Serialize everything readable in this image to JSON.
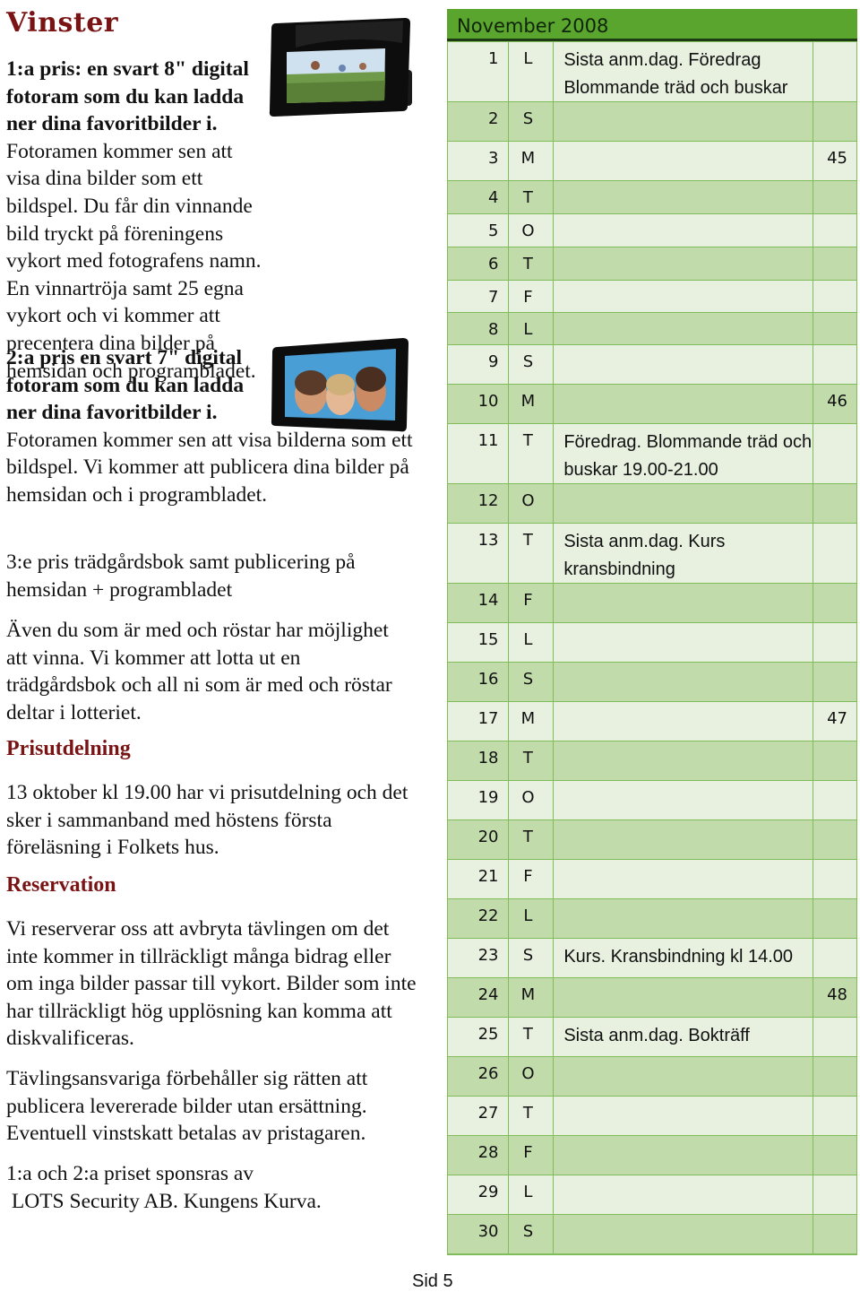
{
  "left": {
    "title": "Vinster",
    "prize1_bold": "1:a pris: en svart 8\" digital fotoram som du kan ladda ner dina favoritbilder i.",
    "prize1_text": "Fotoramen kommer sen att visa dina  bilder som ett bildspel.  Du får din vinnande bild tryckt på föreningens vykort med fotografens namn. En vinnartröja samt 25 egna vykort och vi kommer att precentera dina bilder på hemsidan  och programbladet.",
    "prize2_bold": "2:a pris en svart 7\" digital fotoram som du kan ladda ner dina favoritbilder i.",
    "prize2_text": "Fotoramen kommer sen att visa bilderna som ett bildspel. Vi kommer att publicera dina bilder på hemsidan och i programbladet.",
    "prize3": "3:e pris  trädgårdsbok samt  publicering på hemsidan + programbladet",
    "voters": "Även du som är med och röstar har möjlighet att vinna. Vi kommer att lotta ut en trädgårdsbok och all ni som är med och röstar deltar i lotteriet.",
    "heading_award": "Prisutdelning",
    "award_text": "13 oktober kl 19.00 har vi prisutdelning och det sker i sammanband med höstens första föreläsning i Folkets hus.",
    "heading_reservation": "Reservation",
    "reservation_text": "Vi reserverar oss att avbryta tävlingen om det inte kommer in tillräckligt många bidrag eller om inga bilder passar till vykort. Bilder som inte har tillräckligt hög upplösning kan komma att diskvalificeras.",
    "rights_text": "Tävlingsansvariga förbehåller sig rätten att publicera levererade bilder utan ersättning. Eventuell vinstskatt betalas av pristagaren.",
    "sponsor_line1": "1:a och 2:a priset sponsras av",
    "sponsor_line2": " LOTS Security AB. Kungens Kurva."
  },
  "images": {
    "frame1": "black 8-inch digital photo frame showing people jumping in a field",
    "frame2": "black 7-inch digital photo frame showing three smiling women"
  },
  "calendar": {
    "title": "November 2008",
    "colors": {
      "header": "#5aa52e",
      "row_light": "#e8f0e0",
      "row_dark": "#c2dbab",
      "grid": "#7fbd5a"
    },
    "rows": [
      {
        "day": "1",
        "weekday": "L",
        "event": "Sista anm.dag. Föredrag Blommande träd och buskar",
        "week": ""
      },
      {
        "day": "2",
        "weekday": "S",
        "event": "",
        "week": ""
      },
      {
        "day": "3",
        "weekday": "M",
        "event": "",
        "week": "45"
      },
      {
        "day": "4",
        "weekday": "T",
        "event": "",
        "week": ""
      },
      {
        "day": "5",
        "weekday": "O",
        "event": "",
        "week": ""
      },
      {
        "day": "6",
        "weekday": "T",
        "event": "",
        "week": ""
      },
      {
        "day": "7",
        "weekday": "F",
        "event": "",
        "week": ""
      },
      {
        "day": "8",
        "weekday": "L",
        "event": "",
        "week": ""
      },
      {
        "day": "9",
        "weekday": "S",
        "event": "",
        "week": ""
      },
      {
        "day": "10",
        "weekday": "M",
        "event": "",
        "week": "46"
      },
      {
        "day": "11",
        "weekday": "T",
        "event": "Föredrag. Blommande träd och buskar 19.00-21.00",
        "week": ""
      },
      {
        "day": "12",
        "weekday": "O",
        "event": "",
        "week": ""
      },
      {
        "day": "13",
        "weekday": "T",
        "event": "Sista anm.dag. Kurs kransbindning",
        "week": ""
      },
      {
        "day": "14",
        "weekday": "F",
        "event": "",
        "week": ""
      },
      {
        "day": "15",
        "weekday": "L",
        "event": "",
        "week": ""
      },
      {
        "day": "16",
        "weekday": "S",
        "event": "",
        "week": ""
      },
      {
        "day": "17",
        "weekday": "M",
        "event": "",
        "week": "47"
      },
      {
        "day": "18",
        "weekday": "T",
        "event": "",
        "week": ""
      },
      {
        "day": "19",
        "weekday": "O",
        "event": "",
        "week": ""
      },
      {
        "day": "20",
        "weekday": "T",
        "event": "",
        "week": ""
      },
      {
        "day": "21",
        "weekday": "F",
        "event": "",
        "week": ""
      },
      {
        "day": "22",
        "weekday": "L",
        "event": "",
        "week": ""
      },
      {
        "day": "23",
        "weekday": "S",
        "event": "Kurs. Kransbindning kl 14.00",
        "week": ""
      },
      {
        "day": "24",
        "weekday": "M",
        "event": "",
        "week": "48"
      },
      {
        "day": "25",
        "weekday": "T",
        "event": "Sista anm.dag. Bokträff",
        "week": ""
      },
      {
        "day": "26",
        "weekday": "O",
        "event": "",
        "week": ""
      },
      {
        "day": "27",
        "weekday": "T",
        "event": "",
        "week": ""
      },
      {
        "day": "28",
        "weekday": "F",
        "event": "",
        "week": ""
      },
      {
        "day": "29",
        "weekday": "L",
        "event": "",
        "week": ""
      },
      {
        "day": "30",
        "weekday": "S",
        "event": "",
        "week": ""
      }
    ]
  },
  "footer": {
    "page_label": "Sid 5"
  }
}
